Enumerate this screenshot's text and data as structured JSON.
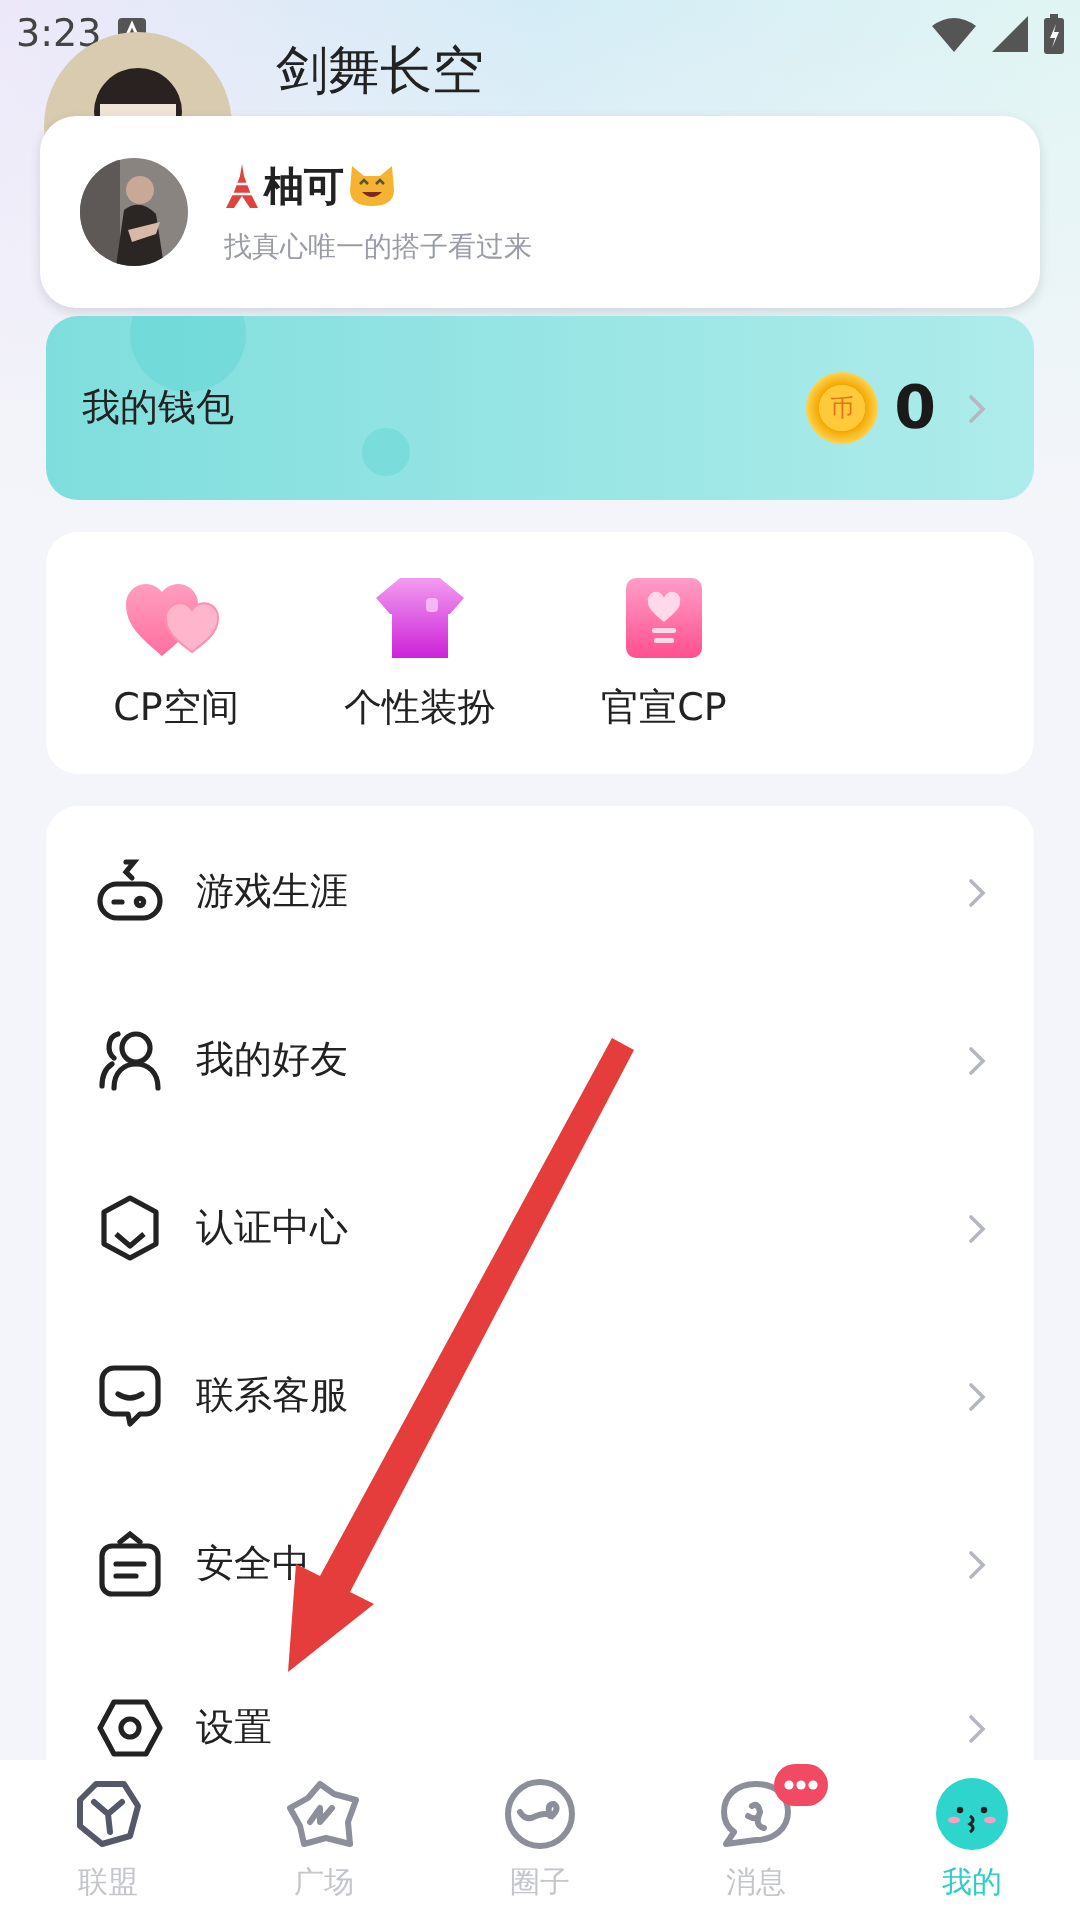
{
  "status_bar": {
    "time": "3:23"
  },
  "profile": {
    "name": "剑舞长空"
  },
  "pinned_contact": {
    "name": "柚可",
    "bio": "找真心唯一的搭子看过来"
  },
  "wallet": {
    "label": "我的钱包",
    "coin_symbol": "币",
    "balance": "0"
  },
  "features": [
    {
      "kind": "hearts",
      "label": "CP空间"
    },
    {
      "kind": "shirt",
      "label": "个性装扮"
    },
    {
      "kind": "card",
      "label": "官宣CP"
    }
  ],
  "menu": [
    {
      "kind": "gamepad",
      "label": "游戏生涯"
    },
    {
      "kind": "friends",
      "label": "我的好友"
    },
    {
      "kind": "shield",
      "label": "认证中心"
    },
    {
      "kind": "chat",
      "label": "联系客服"
    },
    {
      "kind": "safe",
      "label": "安全中"
    },
    {
      "kind": "settings",
      "label": "设置"
    }
  ],
  "tab_bar": [
    {
      "kind": "league",
      "label": "联盟",
      "selected": false,
      "badge": false
    },
    {
      "kind": "square",
      "label": "广场",
      "selected": false,
      "badge": false
    },
    {
      "kind": "circle",
      "label": "圈子",
      "selected": false,
      "badge": false
    },
    {
      "kind": "message",
      "label": "消息",
      "selected": false,
      "badge": true
    },
    {
      "kind": "me",
      "label": "我的",
      "selected": true,
      "badge": false
    }
  ]
}
